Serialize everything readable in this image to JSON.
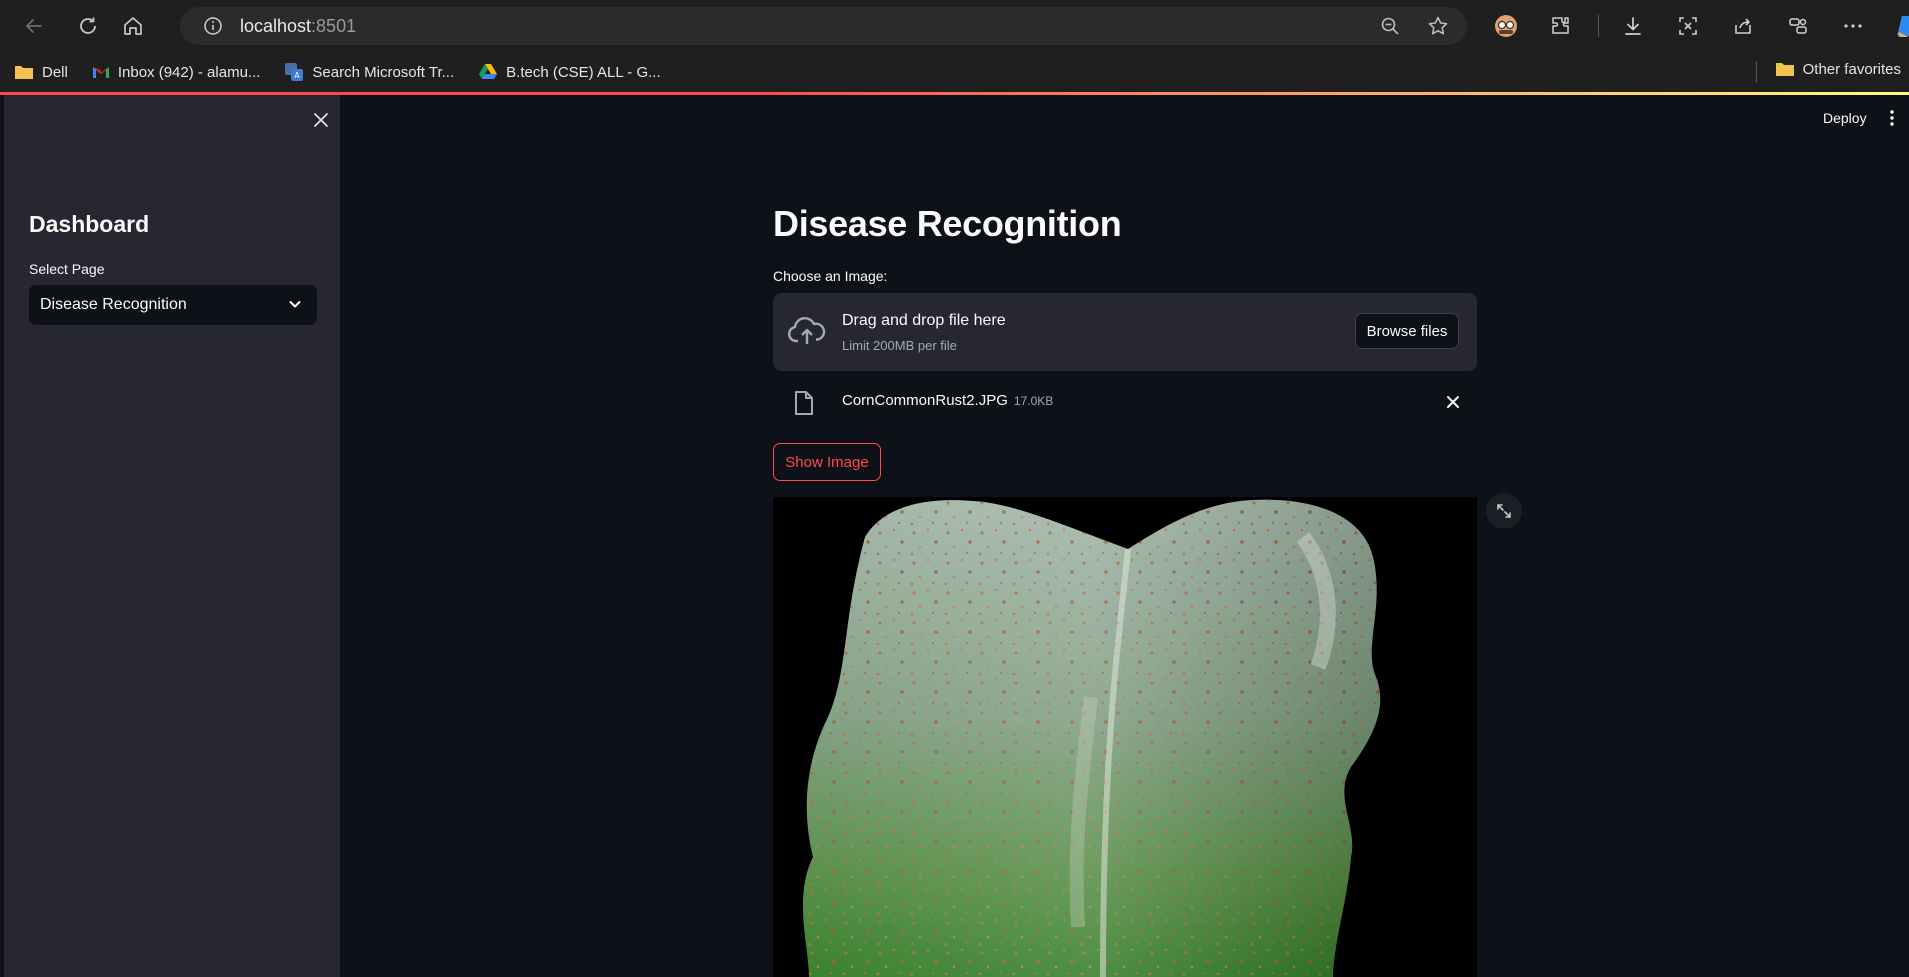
{
  "browser": {
    "url_host": "localhost",
    "url_port": ":8501",
    "bookmarks": [
      {
        "label": "Dell",
        "icon": "folder-icon"
      },
      {
        "label": "Inbox (942) - alamu...",
        "icon": "gmail-icon"
      },
      {
        "label": "Search Microsoft Tr...",
        "icon": "translator-icon"
      },
      {
        "label": "B.tech (CSE) ALL - G...",
        "icon": "drive-icon"
      }
    ],
    "other_favorites": "Other favorites"
  },
  "app": {
    "deploy_label": "Deploy",
    "sidebar": {
      "title": "Dashboard",
      "select_label": "Select Page",
      "selected_page": "Disease Recognition"
    },
    "main": {
      "title": "Disease Recognition",
      "uploader_label": "Choose an Image:",
      "dropzone_title": "Drag and drop file here",
      "dropzone_limit": "Limit 200MB per file",
      "browse_label": "Browse files",
      "file_name": "CornCommonRust2.JPG",
      "file_size": "17.0KB",
      "show_image_label": "Show Image"
    }
  },
  "colors": {
    "app_bg": "#0e1117",
    "sidebar_bg": "#262730",
    "accent": "#ff4b4b"
  }
}
